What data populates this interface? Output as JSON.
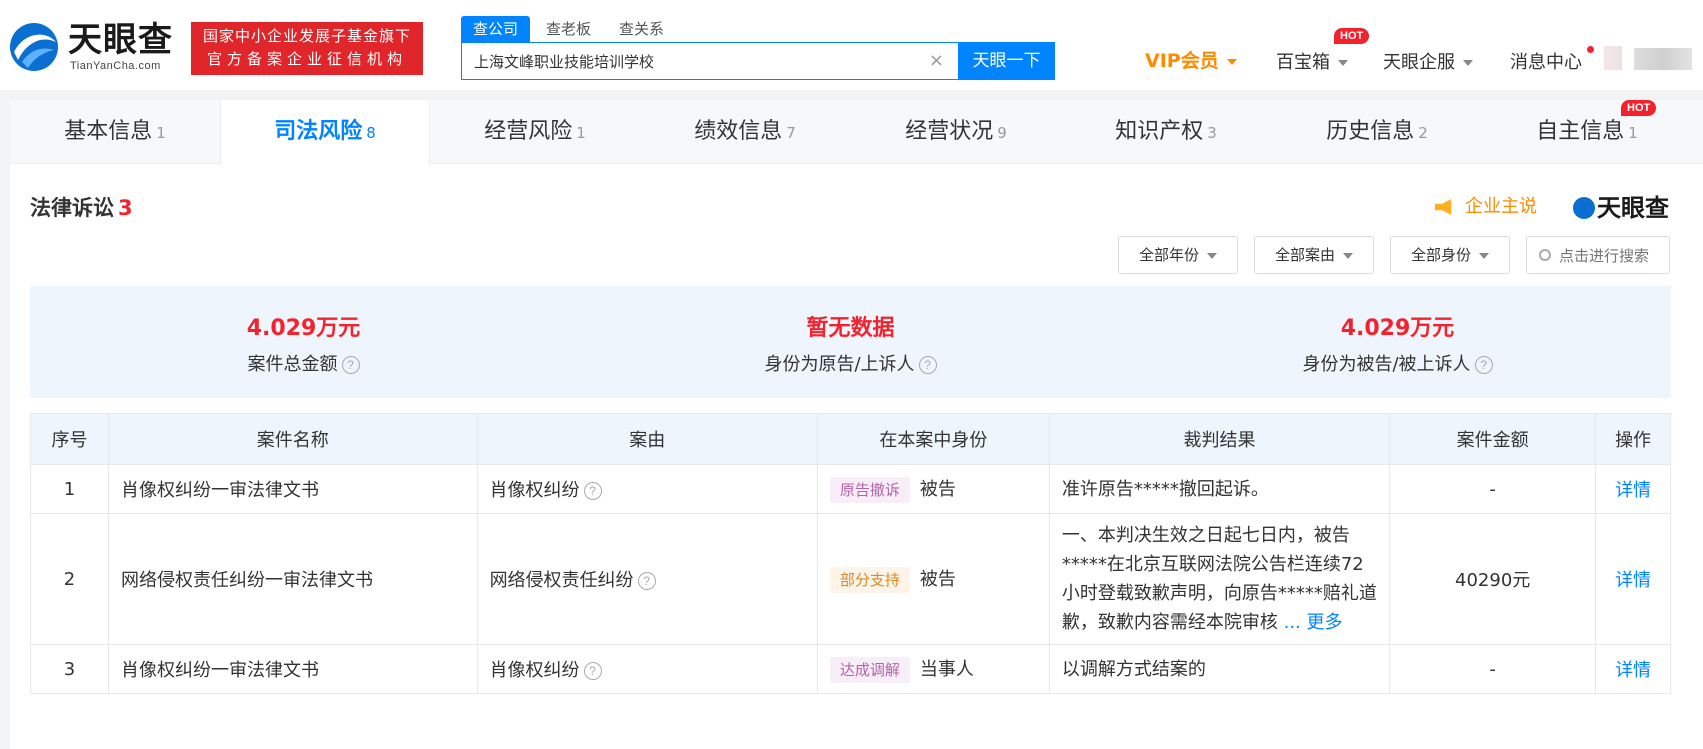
{
  "header": {
    "brand": "天眼查",
    "domain": "TianYanCha.com",
    "badge_line1": "国家中小企业发展子基金旗下",
    "badge_line2": "官方备案企业征信机构",
    "search_tabs": [
      "查公司",
      "查老板",
      "查关系"
    ],
    "search_value": "上海文峰职业技能培训学校",
    "search_button": "天眼一下",
    "vip": "VIP会员",
    "nav": [
      "百宝箱",
      "天眼企服",
      "消息中心"
    ],
    "hot": "HOT"
  },
  "tabs": [
    {
      "label": "基本信息",
      "count": "1"
    },
    {
      "label": "司法风险",
      "count": "8"
    },
    {
      "label": "经营风险",
      "count": "1"
    },
    {
      "label": "绩效信息",
      "count": "7"
    },
    {
      "label": "经营状况",
      "count": "9"
    },
    {
      "label": "知识产权",
      "count": "3"
    },
    {
      "label": "历史信息",
      "count": "2"
    },
    {
      "label": "自主信息",
      "count": "1"
    }
  ],
  "section": {
    "title": "法律诉讼",
    "count": "3",
    "enterprise_say": "企业主说",
    "watermark": "天眼查"
  },
  "filters": {
    "year": "全部年份",
    "cause": "全部案由",
    "role": "全部身份",
    "search_placeholder": "点击进行搜索"
  },
  "stats": [
    {
      "value": "4.029万元",
      "label": "案件总金额"
    },
    {
      "value": "暂无数据",
      "label": "身份为原告/上诉人"
    },
    {
      "value": "4.029万元",
      "label": "身份为被告/被上诉人"
    }
  ],
  "table": {
    "headers": [
      "序号",
      "案件名称",
      "案由",
      "在本案中身份",
      "裁判结果",
      "案件金额",
      "操作"
    ],
    "rows": [
      {
        "no": "1",
        "name": "肖像权纠纷一审法律文书",
        "cause": "肖像权纠纷",
        "tag": "原告撤诉",
        "role": "被告",
        "result": "准许原告*****撤回起诉。",
        "amount": "-",
        "action": "详情"
      },
      {
        "no": "2",
        "name": "网络侵权责任纠纷一审法律文书",
        "cause": "网络侵权责任纠纷",
        "tag": "部分支持",
        "role": "被告",
        "result": "一、本判决生效之日起七日内，被告*****在北京互联网法院公告栏连续72小时登载致歉声明，向原告*****赔礼道歉，致歉内容需经本院审核",
        "more": "... 更多",
        "amount": "40290元",
        "action": "详情"
      },
      {
        "no": "3",
        "name": "肖像权纠纷一审法律文书",
        "cause": "肖像权纠纷",
        "tag": "达成调解",
        "role": "当事人",
        "result": "以调解方式结案的",
        "amount": "-",
        "action": "详情"
      }
    ]
  },
  "icons": {
    "qm": "?",
    "clear": "×"
  }
}
